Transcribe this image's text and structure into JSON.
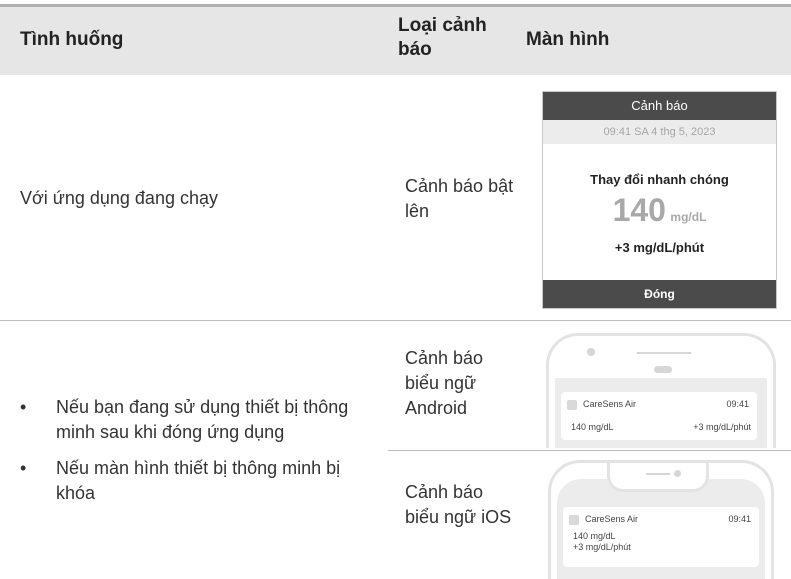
{
  "header": {
    "col_situation": "Tình huống",
    "col_type": "Loại cảnh báo",
    "col_screen": "Màn hình"
  },
  "row1": {
    "situation": "Với ứng dụng đang chạy",
    "type": "Cảnh báo bật lên",
    "popup": {
      "title": "Cảnh báo",
      "time": "09:41 SA 4 thg 5, 2023",
      "message": "Thay đổi nhanh chóng",
      "value": "140",
      "unit": "mg/dL",
      "rate": "+3 mg/dL/phút",
      "close": "Đóng"
    }
  },
  "row2": {
    "bullet1": "Nếu bạn đang sử dụng thiết bị thông minh sau khi đóng ứng dụng",
    "bullet2": "Nếu màn hình thiết bị thông minh bị khóa",
    "android": {
      "type": "Cảnh báo biểu ngữ Android",
      "app": "CareSens Air",
      "time": "09:41",
      "value": "140  mg/dL",
      "rate": "+3 mg/dL/phút"
    },
    "ios": {
      "type": "Cảnh báo biểu ngữ iOS",
      "app": "CareSens Air",
      "time": "09:41",
      "value": "140  mg/dL",
      "rate": "+3 mg/dL/phút"
    }
  }
}
